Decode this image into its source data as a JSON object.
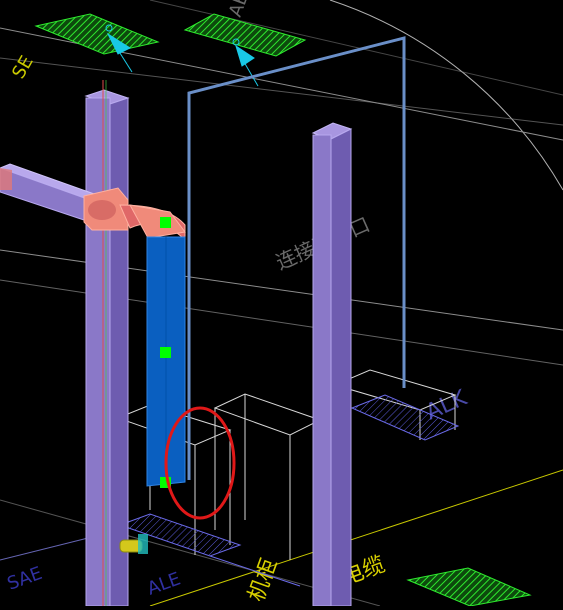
{
  "viewport": {
    "background": "#000000",
    "colors": {
      "column": "#8a78c8",
      "column_edge": "#b7a8ee",
      "duct_elbow": "#e07878",
      "vertical_duct": "#0a5fc0",
      "grip": "#00ff00",
      "pipe": "#6a8fc8",
      "hatch_green": "#2eea2e",
      "gridline": "#8c8c8c",
      "selection_circle": "#e01818",
      "yellow_text": "#d8d000",
      "faded_text": "#6a6a6a",
      "marker": "#19c9e6"
    },
    "annotations": {
      "upper_left_label": "SE",
      "upper_center_label": "AE",
      "mid_rotated_label": "连接到管口",
      "right_rotated_label": "ALK",
      "bottom_left_label": "SAE",
      "bottom_left_label2": "ALE",
      "bottom_yellow_label": "机柜",
      "bottom_yellow_label2": "电缆"
    },
    "icons": [
      "cable-tray-hatch",
      "view-marker-triangle",
      "selection-circle",
      "grip-square"
    ]
  }
}
